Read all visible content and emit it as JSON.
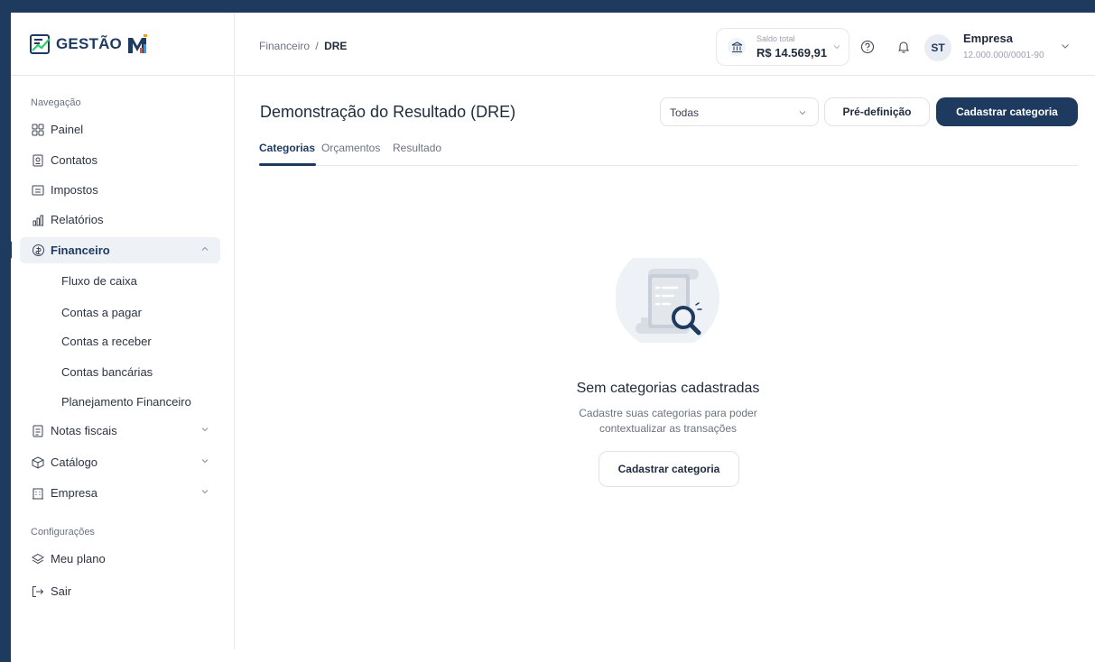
{
  "app": {
    "logo_text": "GESTÃO",
    "logo_mark": "MEI"
  },
  "sidebar": {
    "section_nav": "Navegação",
    "items": [
      {
        "label": "Painel",
        "icon": "grid-icon"
      },
      {
        "label": "Contatos",
        "icon": "contact-card-icon"
      },
      {
        "label": "Impostos",
        "icon": "receipt-icon"
      },
      {
        "label": "Relatórios",
        "icon": "bar-chart-icon"
      },
      {
        "label": "Financeiro",
        "icon": "coins-icon",
        "expanded": true,
        "active": true
      },
      {
        "label": "Notas fiscais",
        "icon": "invoice-icon"
      },
      {
        "label": "Catálogo",
        "icon": "box-icon"
      },
      {
        "label": "Empresa",
        "icon": "building-icon"
      }
    ],
    "financeiro_sub": [
      {
        "label": "Fluxo de caixa"
      },
      {
        "label": "Contas a pagar"
      },
      {
        "label": "Contas a receber"
      },
      {
        "label": "Contas bancárias"
      },
      {
        "label": "Planejamento Financeiro"
      }
    ],
    "section_config": "Configurações",
    "config_items": [
      {
        "label": "Meu plano",
        "icon": "layers-icon"
      },
      {
        "label": "Sair",
        "icon": "logout-icon"
      }
    ]
  },
  "header": {
    "breadcrumb_parent": "Financeiro",
    "breadcrumb_sep": "/",
    "breadcrumb_current": "DRE",
    "saldo_label": "Saldo total",
    "saldo_value": "R$ 14.569,91",
    "avatar_initials": "ST",
    "company_name": "Empresa",
    "company_cnpj": "12.000.000/0001-90"
  },
  "page": {
    "title": "Demonstração do Resultado (DRE)",
    "filter_value": "Todas",
    "predef_button": "Pré-definição",
    "register_button": "Cadastrar categoria",
    "tabs": [
      {
        "label": "Categorias",
        "active": true
      },
      {
        "label": "Orçamentos"
      },
      {
        "label": "Resultado"
      }
    ]
  },
  "empty_state": {
    "title": "Sem categorias cadastradas",
    "description_line1": "Cadastre suas categorias para poder",
    "description_line2": "contextualizar as transações",
    "button": "Cadastrar categoria"
  },
  "colors": {
    "brand": "#1e3a5f",
    "accent_chart": "#e74c3c"
  }
}
